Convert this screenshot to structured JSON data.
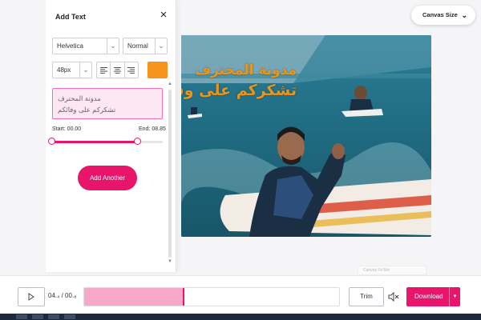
{
  "panel": {
    "title": "Add Text",
    "font_family": "Helvetica",
    "font_weight": "Normal",
    "font_size": "48px",
    "text_color": "#f7941d",
    "text_lines": [
      "مدونة المحترف",
      "تشكركم على وفائكم"
    ],
    "start_label": "Start: 00.00",
    "end_label": "End: 08.85",
    "range": {
      "start_fraction": 0.0,
      "end_fraction": 0.78
    },
    "add_another_label": "Add Another"
  },
  "canvas_size_label": "Canvas Size",
  "preview": {
    "overlay_lines": [
      "مدونة المحترف",
      "تشكركم على وفائكم"
    ]
  },
  "hidden_chip_label": "Canvas Fit Mix",
  "bottom": {
    "time_readout": "04.₄ / 00.₈",
    "progress_fraction": 0.39,
    "trim_label": "Trim",
    "download_label": "Download"
  },
  "colors": {
    "accent": "#e8156b",
    "accent_light": "#f7a7c9",
    "text_overlay": "#e9941a"
  },
  "icons": [
    "close-icon",
    "chevron-down-icon",
    "align-left-icon",
    "align-center-icon",
    "align-right-icon",
    "play-icon",
    "mute-icon"
  ]
}
